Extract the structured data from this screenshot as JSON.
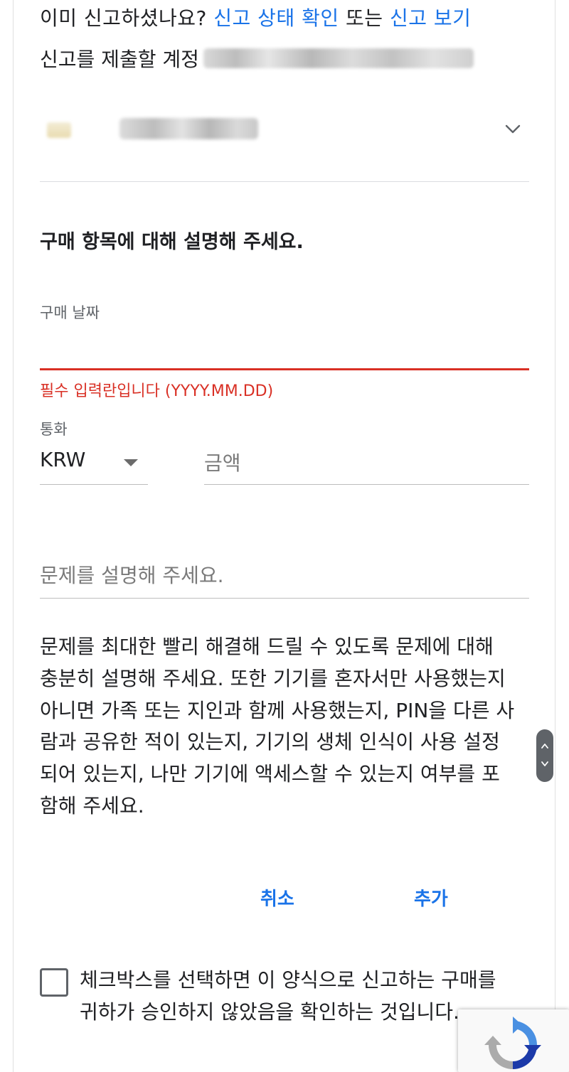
{
  "header": {
    "already_reported_prefix": "이미 신고하셨나요? ",
    "check_status_link": "신고 상태 확인",
    "or_text": " 또는 ",
    "view_report_link": "신고 보기",
    "account_label": "신고를 제출할 계정"
  },
  "device_selector": {
    "icon": "chevron-down-icon"
  },
  "form": {
    "section_title": "구매 항목에 대해 설명해 주세요.",
    "purchase_date_label": "구매 날짜",
    "purchase_date_error": "필수 입력란입니다 (YYYY.MM.DD)",
    "currency_label": "통화",
    "currency_value": "KRW",
    "amount_placeholder": "금액",
    "problem_placeholder": "문제를 설명해 주세요.",
    "help_text": "문제를 최대한 빨리 해결해 드릴 수 있도록 문제에 대해 충분히 설명해 주세요. 또한 기기를 혼자서만 사용했는지 아니면 가족 또는 지인과 함께 사용했는지, PIN을 다른 사람과 공유한 적이 있는지, 기기의 생체 인식이 사용 설정되어 있는지, 나만 기기에 액세스할 수 있는지 여부를 포함해 주세요."
  },
  "actions": {
    "cancel_label": "취소",
    "add_label": "추가"
  },
  "confirmation": {
    "checked": false,
    "text": "체크박스를 선택하면 이 양식으로 신고하는 구매를 귀하가 승인하지 않았음을 확인하는 것입니다."
  },
  "colors": {
    "link": "#1a73e8",
    "error": "#d93025",
    "text": "#202124"
  }
}
